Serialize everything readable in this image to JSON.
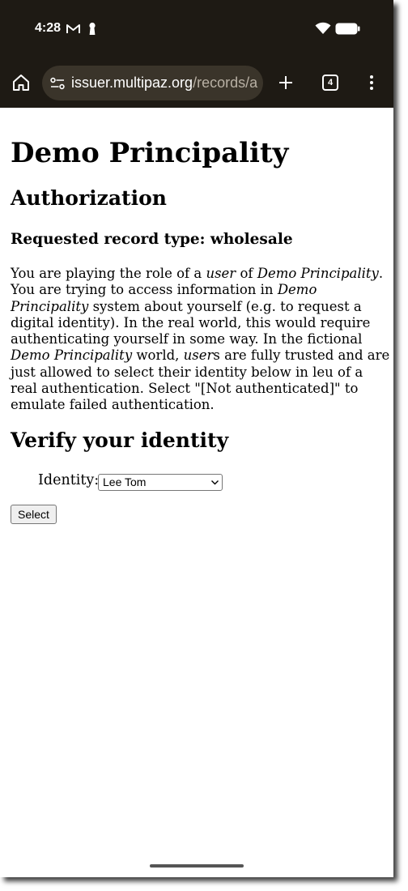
{
  "status_bar": {
    "time": "4:28",
    "icons": [
      "gmail-icon",
      "keyhole-icon",
      "wifi-icon",
      "battery-icon"
    ]
  },
  "browser": {
    "url_host": "issuer.multipaz.org",
    "url_path": "/records/a",
    "tab_count": "4",
    "icons": [
      "home-icon",
      "site-settings-icon",
      "new-tab-icon",
      "tab-switcher-icon",
      "menu-icon"
    ]
  },
  "page": {
    "title": "Demo Principality",
    "heading": "Authorization",
    "subheading": "Requested record type: wholesale",
    "paragraph_lines": [
      [
        {
          "t": "You are playing the role of a "
        },
        {
          "t": "user",
          "i": true
        },
        {
          "t": " of "
        },
        {
          "t": "Demo Principality",
          "i": true
        },
        {
          "t": "."
        }
      ],
      [
        {
          "t": "You are trying to access information in "
        },
        {
          "t": "Demo",
          "i": true
        }
      ],
      [
        {
          "t": "Principality",
          "i": true
        },
        {
          "t": " system about yourself (e.g. to request a"
        }
      ],
      [
        {
          "t": "digital identity). In the real world, this would require"
        }
      ],
      [
        {
          "t": "authenticating yourself in some way. In the fictional"
        }
      ],
      [
        {
          "t": "Demo Principality",
          "i": true
        },
        {
          "t": " world, "
        },
        {
          "t": "user",
          "i": true
        },
        {
          "t": "s are fully trusted and are"
        }
      ],
      [
        {
          "t": "just allowed to select their identity below in leu of a"
        }
      ],
      [
        {
          "t": "real authentication. Select \"[Not authenticated]\" to"
        }
      ],
      [
        {
          "t": "emulate failed authentication."
        }
      ]
    ],
    "verify_heading": "Verify your identity",
    "identity_label": "Identity:",
    "identity_selected": "Lee Tom",
    "select_button": "Select"
  },
  "colors": {
    "chrome_bg": "#1e1a14",
    "urlbar_bg": "#3a342a",
    "url_path": "#b8b0a4"
  }
}
